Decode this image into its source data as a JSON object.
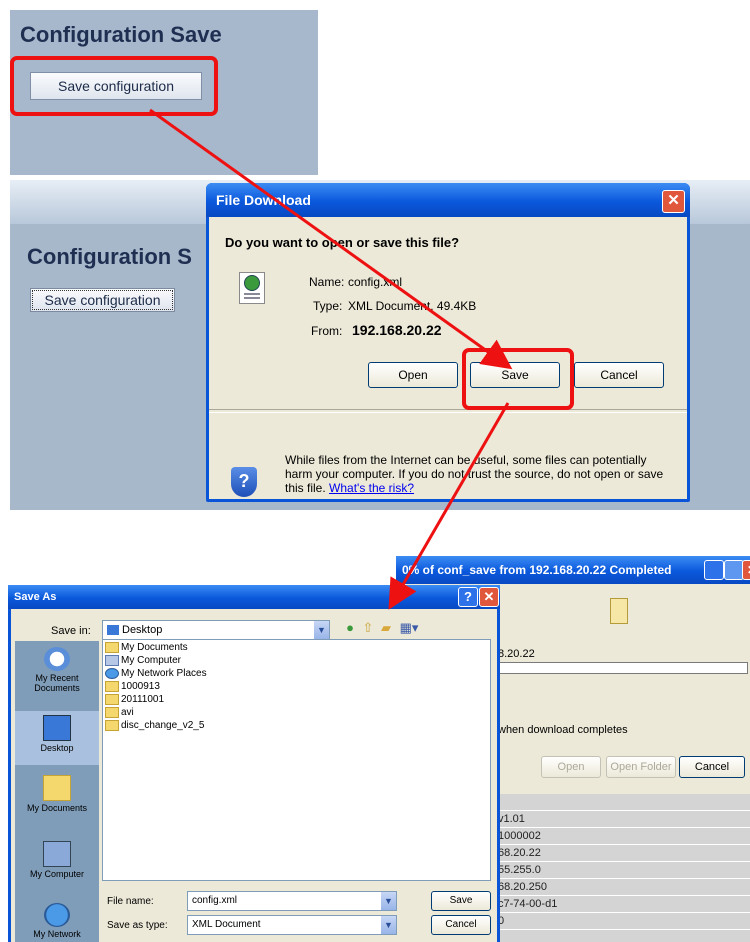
{
  "panel1": {
    "title": "Configuration Save",
    "button_label": "Save configuration"
  },
  "panel2": {
    "title": "Configuration S",
    "button_label": "Save configuration"
  },
  "file_download": {
    "title": "File Download",
    "question": "Do you want to open or save this file?",
    "name_label": "Name:",
    "name_value": "config.xml",
    "type_label": "Type:",
    "type_value": "XML Document, 49.4KB",
    "from_label": "From:",
    "from_value": "192.168.20.22",
    "open_label": "Open",
    "save_label": "Save",
    "cancel_label": "Cancel",
    "warning_text": "While files from the Internet can be useful, some files can potentially harm your computer. If you do not trust the source, do not open or save this file.",
    "risk_link": "What's the risk?"
  },
  "download_progress": {
    "title": "0% of conf_save from 192.168.20.22 Completed",
    "address_fragment": "8.20.22",
    "checkbox_fragment": "when download completes",
    "open_label": "Open",
    "open_folder_label": "Open Folder",
    "cancel_label": "Cancel",
    "table_fragments": [
      "v1.01",
      "1000002",
      "68.20.22",
      "55.255.0",
      "68.20.250",
      "c7-74-00-d1",
      "0"
    ]
  },
  "save_as": {
    "title": "Save As",
    "save_in_label": "Save in:",
    "save_in_value": "Desktop",
    "places": [
      "My Recent Documents",
      "Desktop",
      "My Documents",
      "My Computer",
      "My Network"
    ],
    "items": [
      "My Documents",
      "My Computer",
      "My Network Places",
      "1000913",
      "20111001",
      "avi",
      "disc_change_v2_5"
    ],
    "file_name_label": "File name:",
    "file_name_value": "config.xml",
    "save_type_label": "Save as type:",
    "save_type_value": "XML Document",
    "save_label": "Save",
    "cancel_label": "Cancel"
  },
  "colors": {
    "highlight": "#ee1111",
    "xp_title": "#0a58dc",
    "page_bg": "#a8b8cb"
  }
}
